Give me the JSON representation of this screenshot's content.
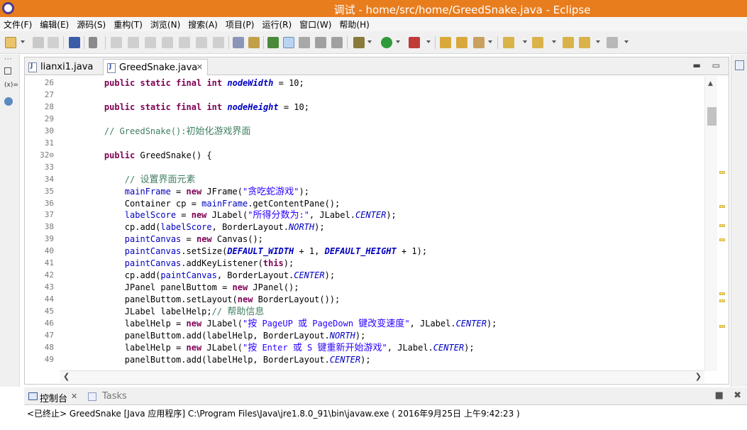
{
  "window": {
    "title": "调试 - home/src/home/GreedSnake.java - Eclipse"
  },
  "menu": [
    "文件(F)",
    "编辑(E)",
    "源码(S)",
    "重构(T)",
    "浏览(N)",
    "搜索(A)",
    "项目(P)",
    "运行(R)",
    "窗口(W)",
    "帮助(H)"
  ],
  "left_trim": {
    "variables_label": "(x)="
  },
  "editor": {
    "tabs": [
      {
        "label": "lianxi1.java",
        "active": false
      },
      {
        "label": "GreedSnake.java",
        "active": true
      }
    ],
    "lines": [
      {
        "n": "26",
        "html": "    <span class=\"kw\">public</span> <span class=\"kw\">static</span> <span class=\"kw\">final</span> <span class=\"kw\">int</span> <span class=\"sf\">nodeWidth</span> = 10;"
      },
      {
        "n": "27",
        "html": ""
      },
      {
        "n": "28",
        "html": "    <span class=\"kw\">public</span> <span class=\"kw\">static</span> <span class=\"kw\">final</span> <span class=\"kw\">int</span> <span class=\"sf\">nodeHeight</span> = 10;"
      },
      {
        "n": "29",
        "html": ""
      },
      {
        "n": "30",
        "html": "    <span class=\"cm\">// GreedSnake():</span><span class=\"cmz\">初始化游戏界面</span>"
      },
      {
        "n": "31",
        "html": ""
      },
      {
        "n": "32",
        "html": "    <span class=\"kw\">public</span> GreedSnake() {"
      },
      {
        "n": "33",
        "html": ""
      },
      {
        "n": "34",
        "html": "        <span class=\"cm\">// </span><span class=\"cmz\">设置界面元素</span>"
      },
      {
        "n": "35",
        "html": "        <span class=\"fi\">mainFrame</span> = <span class=\"kw\">new</span> JFrame(<span class=\"st\">\"<span class=\"zh\">贪吃蛇游戏</span>\"</span>);"
      },
      {
        "n": "36",
        "html": "        Container cp = <span class=\"fi\">mainFrame</span>.getContentPane();"
      },
      {
        "n": "37",
        "html": "        <span class=\"fi\">labelScore</span> = <span class=\"kw\">new</span> JLabel(<span class=\"st\">\"<span class=\"zh\">所得分数为</span>:\"</span>, JLabel.<span class=\"sfi\">CENTER</span>);"
      },
      {
        "n": "38",
        "html": "        cp.add(<span class=\"fi\">labelScore</span>, BorderLayout.<span class=\"sfi\">NORTH</span>);"
      },
      {
        "n": "39",
        "html": "        <span class=\"fi\">paintCanvas</span> = <span class=\"kw\">new</span> Canvas();"
      },
      {
        "n": "40",
        "html": "        <span class=\"fi\">paintCanvas</span>.setSize(<span class=\"sf\">DEFAULT_WIDTH</span> + 1, <span class=\"sf\">DEFAULT_HEIGHT</span> + 1);"
      },
      {
        "n": "41",
        "html": "        <span class=\"fi\">paintCanvas</span>.addKeyListener(<span class=\"kw\">this</span>);"
      },
      {
        "n": "42",
        "html": "        cp.add(<span class=\"fi\">paintCanvas</span>, BorderLayout.<span class=\"sfi\">CENTER</span>);"
      },
      {
        "n": "43",
        "html": "        JPanel panelButtom = <span class=\"kw\">new</span> JPanel();"
      },
      {
        "n": "44",
        "html": "        panelButtom.setLayout(<span class=\"kw\">new</span> BorderLayout());"
      },
      {
        "n": "45",
        "html": "        JLabel labelHelp;<span class=\"cm\">// </span><span class=\"cmz\">帮助信息</span>"
      },
      {
        "n": "46",
        "html": "        labelHelp = <span class=\"kw\">new</span> JLabel(<span class=\"st\">\"<span class=\"zh\">按</span> PageUP <span class=\"zh\">或</span> PageDown <span class=\"zh\">键改变速度</span>\"</span>, JLabel.<span class=\"sfi\">CENTER</span>);"
      },
      {
        "n": "47",
        "html": "        panelButtom.add(labelHelp, BorderLayout.<span class=\"sfi\">NORTH</span>);"
      },
      {
        "n": "48",
        "html": "        labelHelp = <span class=\"kw\">new</span> JLabel(<span class=\"st\">\"<span class=\"zh\">按</span> Enter <span class=\"zh\">或</span> S <span class=\"zh\">键重新开始游戏</span>\"</span>, JLabel.<span class=\"sfi\">CENTER</span>);"
      },
      {
        "n": "49",
        "html": "        panelButtom.add(labelHelp, BorderLayout.<span class=\"sfi\">CENTER</span>);"
      }
    ]
  },
  "console": {
    "tabs": [
      {
        "label": "控制台"
      },
      {
        "label": "Tasks"
      }
    ],
    "text": "<已终止> GreedSnake [Java 应用程序] C:\\Program Files\\Java\\jre1.8.0_91\\bin\\javaw.exe ( 2016年9月25日 上午9:42:23 )"
  },
  "colors": {
    "titlebar": "#e87d1e",
    "keyword": "#7f0055",
    "field": "#0000c0",
    "string": "#2a00ff",
    "comment": "#3f7f5f"
  }
}
